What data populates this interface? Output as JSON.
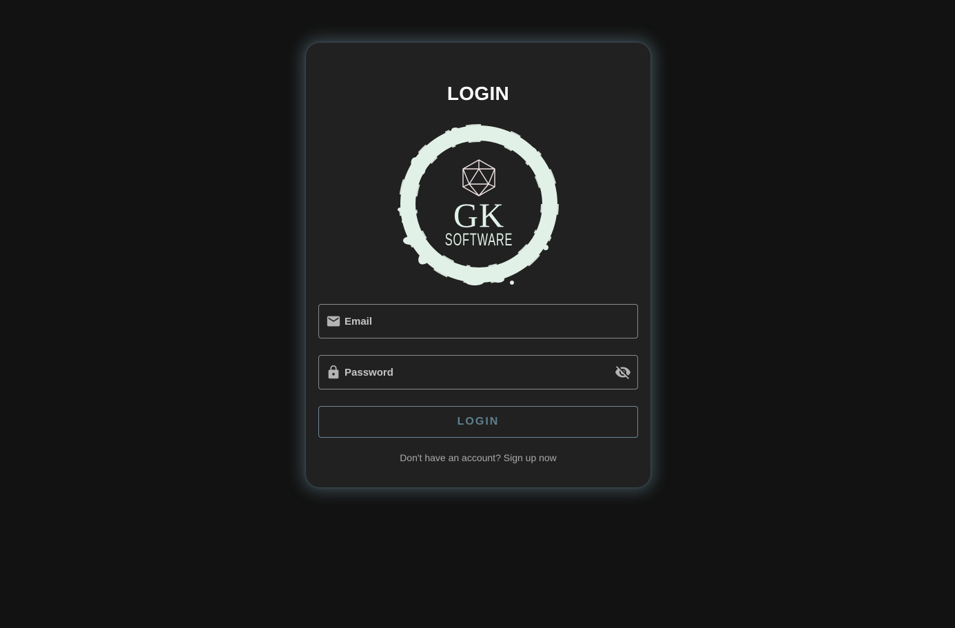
{
  "login_form": {
    "title": "LOGIN",
    "logo": {
      "initials": "GK",
      "wordmark": "SOFTWARE",
      "icon": "d20-icon",
      "ring_color": "#e2f1e7",
      "mark_color": "#f2e6e6"
    },
    "email": {
      "placeholder": "Email",
      "value": "",
      "icon": "mail-icon"
    },
    "password": {
      "placeholder": "Password",
      "value": "",
      "icon": "lock-icon",
      "toggle_icon": "eye-off-icon"
    },
    "submit_label": "LOGIN",
    "signup_text": "Don't have an account? Sign up now"
  },
  "colors": {
    "background": "#121212",
    "card": "#212121",
    "glow": "#78a0af",
    "button_text": "#5f7f8e"
  }
}
